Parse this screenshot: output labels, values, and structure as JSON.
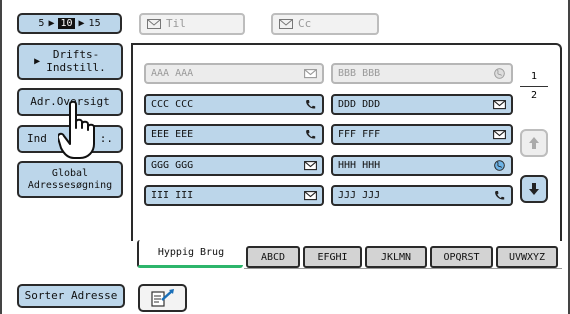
{
  "pager": {
    "prev": "5",
    "current": "10",
    "next": "15"
  },
  "recipient_buttons": {
    "to": "Til",
    "cc": "Cc"
  },
  "sidebar": {
    "settings": "Drifts-\nIndstill.",
    "address_list": "Adr.Oversigt",
    "index_prefix": "Ind",
    "index_suffix": ":.",
    "global_search": "Global\nAdressesøgning",
    "sort": "Sorter Adresse"
  },
  "addresses": [
    {
      "name": "AAA AAA",
      "icon": "email-icon",
      "enabled": false
    },
    {
      "name": "BBB BBB",
      "icon": "globe-icon",
      "enabled": false
    },
    {
      "name": "CCC CCC",
      "icon": "phone-icon",
      "enabled": true
    },
    {
      "name": "DDD DDD",
      "icon": "email-icon",
      "enabled": true
    },
    {
      "name": "EEE EEE",
      "icon": "phone-icon",
      "enabled": true
    },
    {
      "name": "FFF FFF",
      "icon": "email-icon",
      "enabled": true
    },
    {
      "name": "GGG GGG",
      "icon": "email-icon",
      "enabled": true
    },
    {
      "name": "HHH HHH",
      "icon": "globe-icon",
      "enabled": true
    },
    {
      "name": "III III",
      "icon": "email-icon",
      "enabled": true
    },
    {
      "name": "JJJ JJJ",
      "icon": "phone-icon",
      "enabled": true
    }
  ],
  "page_indicator": {
    "current": "1",
    "total": "2"
  },
  "tabs": [
    "Hyppig Brug",
    "ABCD",
    "EFGHI",
    "JKLMN",
    "OPQRST",
    "UVWXYZ"
  ],
  "colors": {
    "button_fill": "#bcd6ea",
    "active_tab_underline": "#2db56b"
  }
}
